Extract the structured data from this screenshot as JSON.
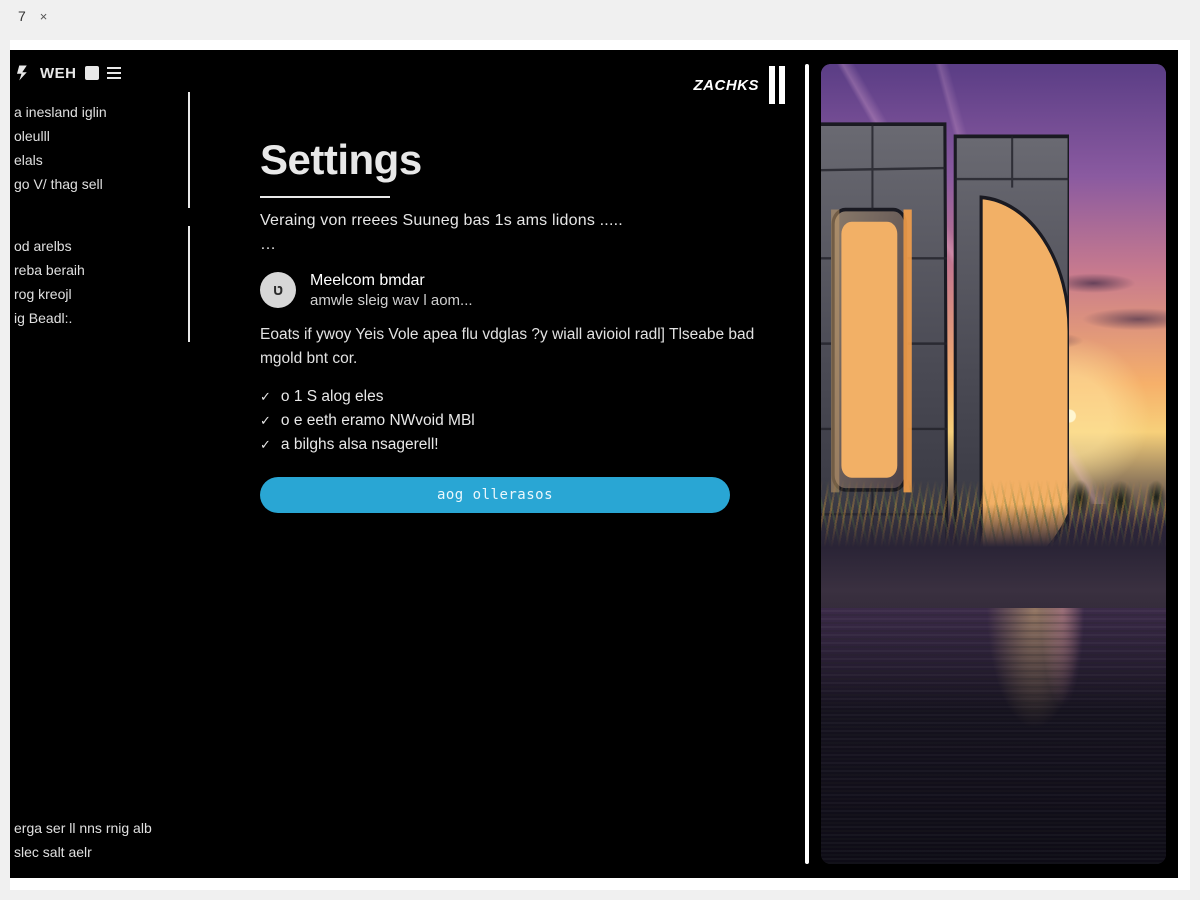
{
  "window": {
    "tab_label": "7",
    "tab_close": "×"
  },
  "header": {
    "brand_left": "WEH",
    "brand_right": "ZACHKS"
  },
  "sidebar": {
    "group1": [
      "a inesland iglin",
      "oleulll",
      "elals",
      "go V/ thag sell"
    ],
    "group2": [
      "od arelbs",
      "reba beraih",
      "rog kreojl",
      "ig Beadl:."
    ],
    "footer": [
      "erga ser ll nns rnig alb",
      "slec salt aelr"
    ]
  },
  "page": {
    "title": "Settings",
    "subtitle": "Veraing von rreees Suuneg bas 1s ams lidons .....",
    "dots": "…",
    "setting": {
      "icon_glyph": "ט",
      "label": "Meelcom bmdar",
      "desc": "amwle sleig wav l aom..."
    },
    "body": "Eoats if ywoy Yeis Vole apea flu vdglas ?y wiall avioiol radl] Tlseabe bad mgold bnt cor.",
    "checklist": [
      "o 1 S alog eles",
      "o e eeth eramo NWvoid MBl",
      "a bilghs alsa nsagerell!"
    ],
    "cta_label": "aog ollerasos"
  }
}
